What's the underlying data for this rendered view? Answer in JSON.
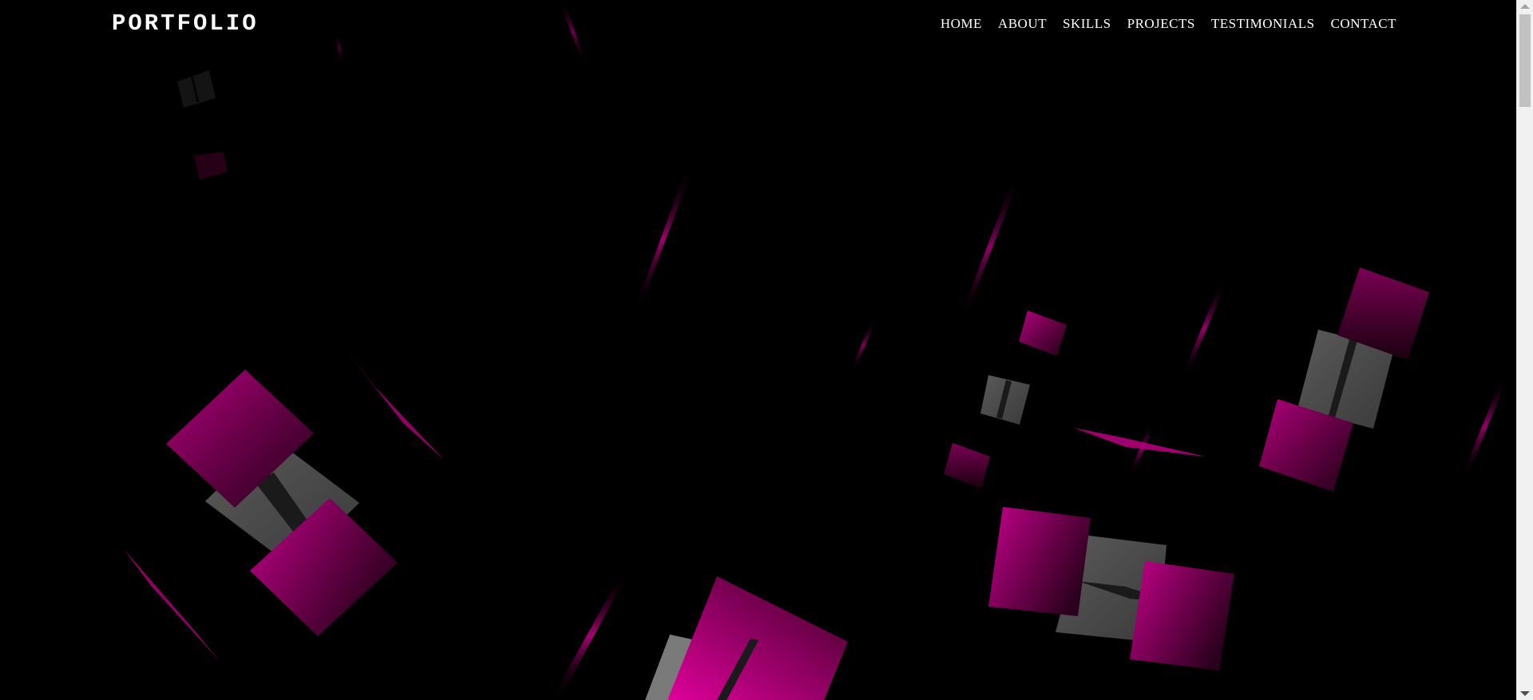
{
  "header": {
    "logo": "PORTFOLIO",
    "nav": [
      {
        "label": "HOME"
      },
      {
        "label": "ABOUT"
      },
      {
        "label": "SKILLS"
      },
      {
        "label": "PROJECTS"
      },
      {
        "label": "TESTIMONIALS"
      },
      {
        "label": "CONTACT"
      }
    ]
  },
  "colors": {
    "background": "#000000",
    "accent_magenta": "#c0007f",
    "accent_dark_magenta": "#6a0045",
    "cube_gray": "#4a4a4a",
    "text": "#ffffff"
  },
  "scene": {
    "description_icon": "floating-3d-cubes-background"
  }
}
